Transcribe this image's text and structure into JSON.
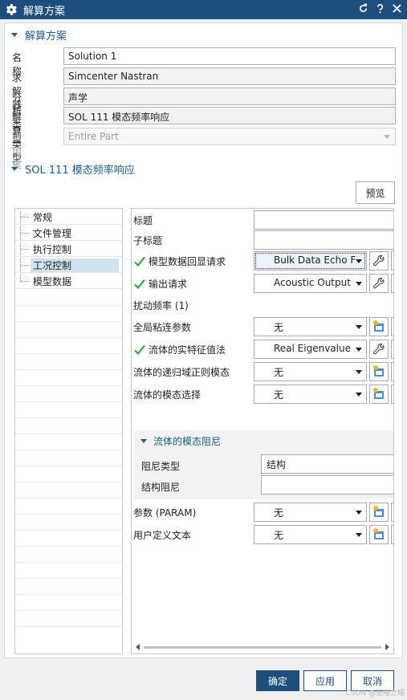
{
  "window": {
    "title": "解算方案",
    "colors": {
      "titlebar": "#1c4e7e",
      "accent": "#1a5f91",
      "check": "#2ea83a"
    }
  },
  "section_solution": {
    "header": "解算方案",
    "fields": [
      {
        "label": "名称",
        "value": "Solution 1",
        "editable": true
      },
      {
        "label": "求解器",
        "value": "Simcenter Nastran",
        "editable": false
      },
      {
        "label": "分析类型",
        "value": "声学",
        "editable": false
      },
      {
        "label": "解算类型",
        "value": "SOL 111 模态频率响应",
        "editable": false
      }
    ],
    "reference_set": {
      "label": "引用集",
      "value": "Entire Part",
      "disabled": true
    }
  },
  "section_sol": {
    "header": "SOL 111 模态频率响应",
    "preview_label": "预览"
  },
  "tree": {
    "items": [
      {
        "label": "常规",
        "selected": false
      },
      {
        "label": "文件管理",
        "selected": false
      },
      {
        "label": "执行控制",
        "selected": false
      },
      {
        "label": "工况控制",
        "selected": true
      },
      {
        "label": "模型数据",
        "selected": false
      }
    ]
  },
  "case_control": {
    "title_label": "标题",
    "subtitle_label": "子标题",
    "model_echo": {
      "label": "模型数据回显请求",
      "value": "Bulk Data Echo F",
      "checked": true,
      "icon": "wrench-icon"
    },
    "output_request": {
      "label": "输出请求",
      "value": "Acoustic Output",
      "checked": true,
      "icon": "wrench-icon"
    },
    "excitation_freq": {
      "label": "扰动频率 (1)"
    },
    "global_viscous": {
      "label": "全局粘连参数",
      "value": "无",
      "icon": "new-object-icon"
    },
    "fluid_eigen": {
      "label": "流体的实特征值法",
      "value": "Real Eigenvalue",
      "checked": true,
      "icon": "wrench-icon"
    },
    "fluid_recursive": {
      "label": "流体的递归域正则模态",
      "value": "无",
      "icon": "new-object-icon"
    },
    "fluid_mode_select": {
      "label": "流体的模态选择",
      "value": "无",
      "icon": "new-object-icon"
    },
    "fluid_damping": {
      "header": "流体的模态阻尼",
      "damping_type_label": "阻尼类型",
      "damping_type_value": "结构",
      "structural_damping_label": "结构阻尼",
      "structural_damping_value": ""
    },
    "param": {
      "label": "参数 (PARAM)",
      "value": "无",
      "icon": "new-object-icon"
    },
    "user_text": {
      "label": "用户定义文本",
      "value": "无",
      "icon": "new-object-icon"
    }
  },
  "buttons": {
    "ok": "确定",
    "apply": "应用",
    "cancel": "取消"
  },
  "watermark": "CSDN @圣瞳之眼"
}
